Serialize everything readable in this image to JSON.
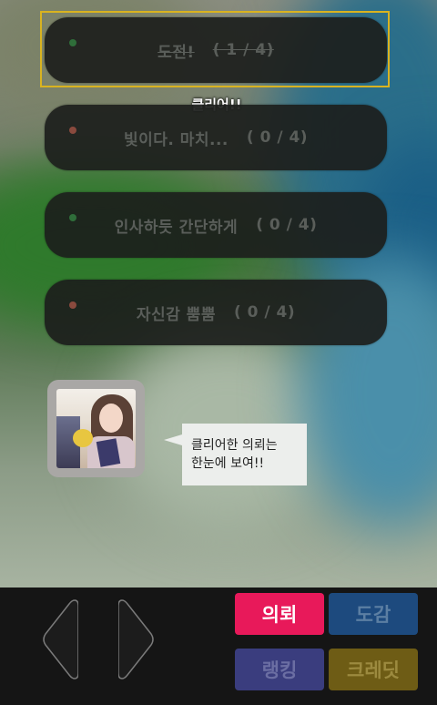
{
  "quests": [
    {
      "title": "도전!",
      "count": "( 1 / 4)",
      "status": "cleared",
      "dot_color": "#2f6e3a"
    },
    {
      "title": "빛이다. 마치...",
      "count": "( 0 / 4)",
      "status": "open",
      "dot_color": "#8a4a3e"
    },
    {
      "title": "인사하듯 간단하게",
      "count": "( 0 / 4)",
      "status": "open",
      "dot_color": "#2f6e3a"
    },
    {
      "title": "자신감 뿜뿜",
      "count": "( 0 / 4)",
      "status": "open",
      "dot_color": "#8a4a3e"
    }
  ],
  "clear_label": "클리어!!",
  "speech_bubble": {
    "line1": "클리어한 의뢰는",
    "line2": "한눈에 보여!!"
  },
  "nav": {
    "prev_icon": "left-arrow-icon",
    "next_icon": "right-arrow-icon"
  },
  "menu": {
    "quest": {
      "label": "의뢰",
      "bg": "#e8195a",
      "color": "#ffffff"
    },
    "collection": {
      "label": "도감",
      "bg": "#1d4a7e",
      "color": "#5c7fa3"
    },
    "ranking": {
      "label": "랭킹",
      "bg": "#3a3d7e",
      "color": "#6b6ea3"
    },
    "credits": {
      "label": "크레딧",
      "bg": "#6e5c15",
      "color": "#9c8a3f"
    }
  }
}
